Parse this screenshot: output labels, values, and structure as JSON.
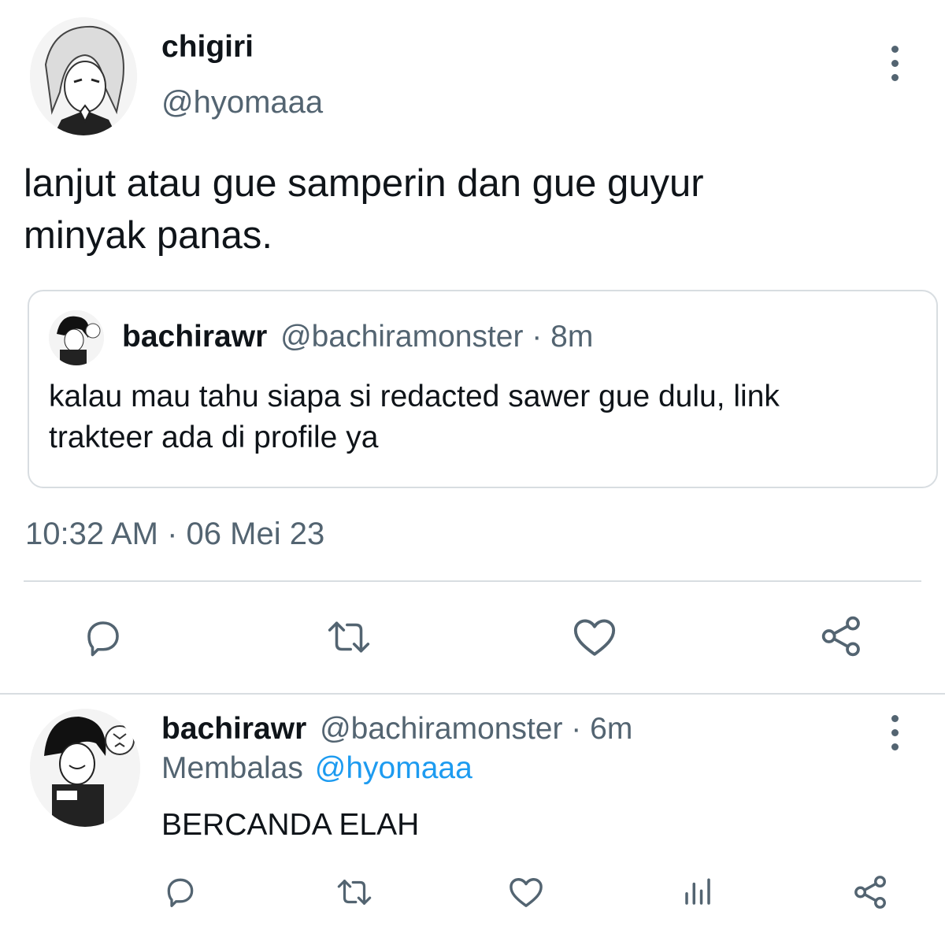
{
  "main_tweet": {
    "display_name": "chigiri",
    "handle": "@hyomaaa",
    "text_line1": "lanjut atau gue samperin dan gue guyur",
    "text_line2": "minyak panas.",
    "timestamp": "10:32 AM · 06 Mei 23",
    "quoted": {
      "display_name": "bachirawr",
      "handle_time": "@bachiramonster · 8m",
      "text_line1": "kalau mau tahu siapa si redacted sawer gue dulu, link",
      "text_line2": "trakteer ada di profile ya"
    }
  },
  "reply": {
    "display_name": "bachirawr",
    "handle_time": "@bachiramonster · 6m",
    "replying_prefix": "Membalas",
    "replying_to": "@hyomaaa",
    "text": "BERCANDA ELAH"
  },
  "icons": {
    "reply": "reply-icon",
    "retweet": "retweet-icon",
    "like": "like-icon",
    "share": "share-icon",
    "views": "views-icon",
    "more": "more-options-icon"
  },
  "colors": {
    "text": "#0f1419",
    "secondary": "#536471",
    "link": "#1d9bf0",
    "divider": "#d8dde1"
  }
}
